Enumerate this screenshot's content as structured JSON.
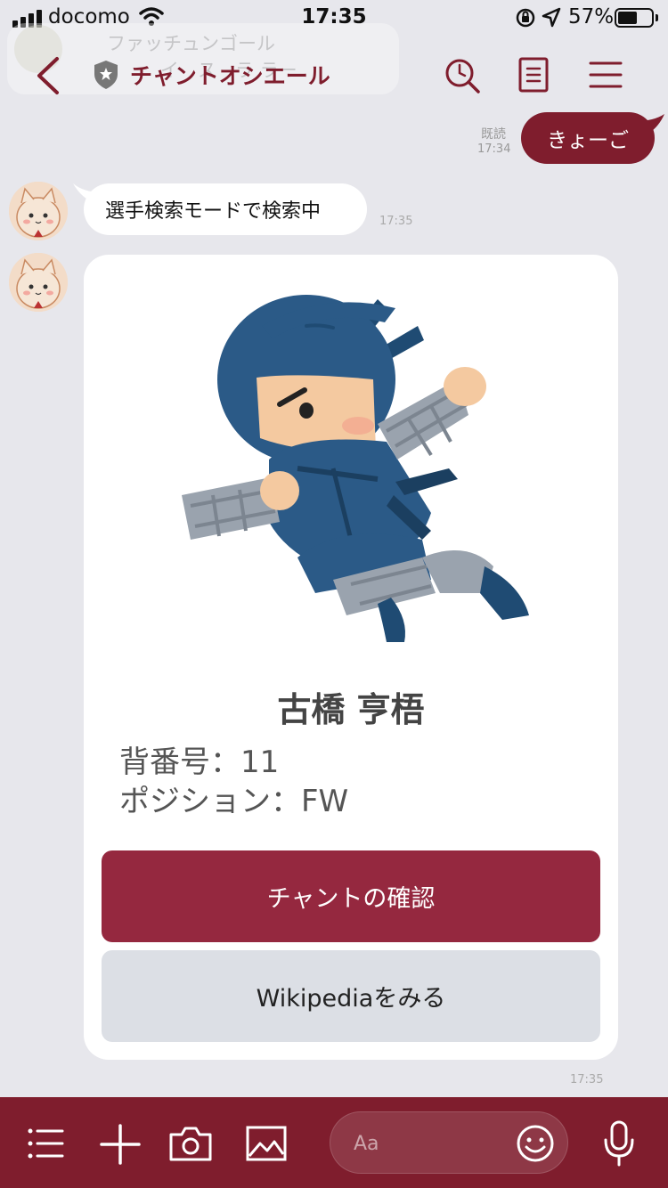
{
  "status_bar": {
    "carrier": "docomo",
    "time": "17:35",
    "battery": "57%",
    "battery_level": 0.57
  },
  "background_preview": {
    "line1": "ファッチュンゴール",
    "line2": "イ　ス　ラ ラー"
  },
  "header": {
    "title": "チャントオシエール",
    "icons": [
      "back-icon",
      "shield-icon",
      "search-icon",
      "notes-icon",
      "menu-icon"
    ]
  },
  "messages": {
    "outgoing": {
      "text": "きょーご",
      "read_label": "既読",
      "time": "17:34"
    },
    "incoming": {
      "text": "選手検索モードで検索中",
      "time": "17:35"
    },
    "card": {
      "player_name": "古橋 亨梧",
      "number_line": "背番号：11",
      "position_line": "ポジション：FW",
      "primary_button": "チャントの確認",
      "secondary_button": "Wikipediaをみる",
      "time": "17:35"
    }
  },
  "input_bar": {
    "placeholder": "Aa",
    "icons": [
      "list-icon",
      "plus-icon",
      "camera-icon",
      "image-icon",
      "emoji-icon",
      "mic-icon"
    ]
  },
  "colors": {
    "brand": "#7f1d2d",
    "primary_button": "#95283f",
    "secondary_button": "#dcdfe5",
    "background": "#e7e7ec"
  }
}
